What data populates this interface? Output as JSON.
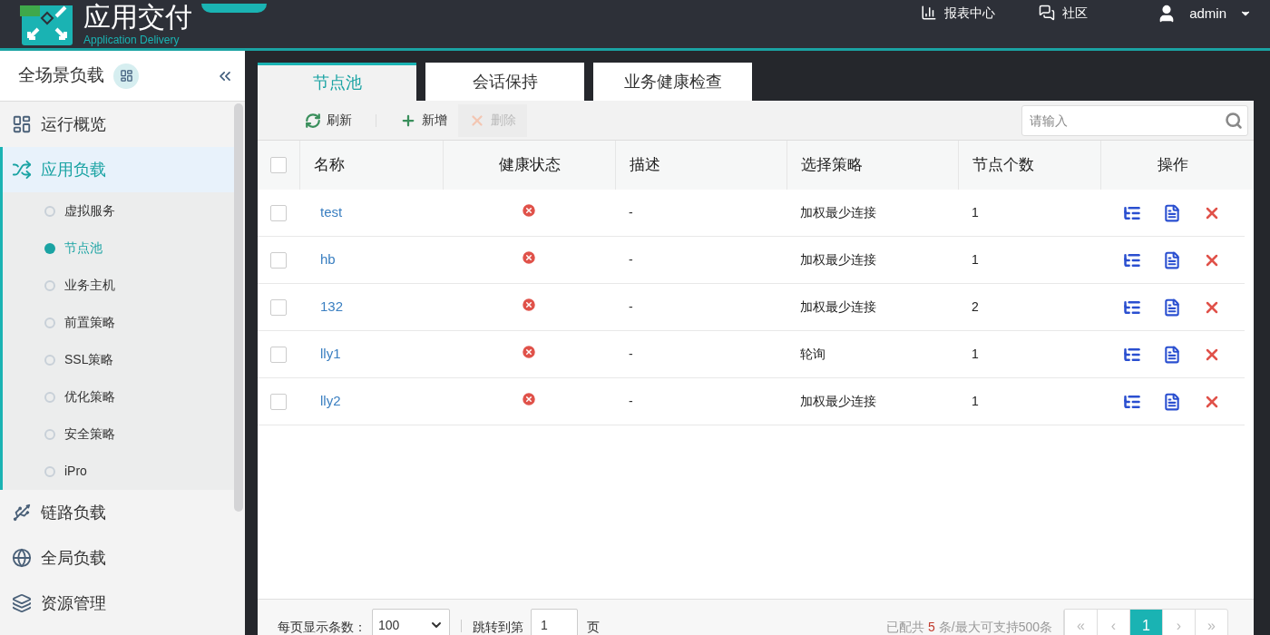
{
  "header": {
    "title": "应用交付",
    "subtitle": "Application Delivery",
    "links": [
      {
        "label": "报表中心"
      },
      {
        "label": "社区"
      }
    ],
    "user": "admin"
  },
  "sidebar": {
    "title": "全场景负载",
    "items": [
      {
        "label": "运行概览",
        "selected": false
      },
      {
        "label": "应用负载",
        "selected": true,
        "expanded": true,
        "children": [
          {
            "label": "虚拟服务",
            "selected": false
          },
          {
            "label": "节点池",
            "selected": true
          },
          {
            "label": "业务主机",
            "selected": false
          },
          {
            "label": "前置策略",
            "selected": false
          },
          {
            "label": "SSL策略",
            "selected": false
          },
          {
            "label": "优化策略",
            "selected": false
          },
          {
            "label": "安全策略",
            "selected": false
          },
          {
            "label": "iPro",
            "selected": false
          }
        ]
      },
      {
        "label": "链路负载",
        "selected": false
      },
      {
        "label": "全局负载",
        "selected": false
      },
      {
        "label": "资源管理",
        "selected": false
      }
    ]
  },
  "tabs": [
    {
      "label": "节点池",
      "selected": true
    },
    {
      "label": "会话保持",
      "selected": false
    },
    {
      "label": "业务健康检查",
      "selected": false
    }
  ],
  "toolbar": {
    "buttons": [
      {
        "label": "刷新",
        "disabled": false
      },
      {
        "label": "新增",
        "disabled": false
      },
      {
        "label": "删除",
        "disabled": true
      }
    ],
    "search": {
      "placeholder": "请输入"
    }
  },
  "table": {
    "all_checked": false,
    "columns": [
      "名称",
      "健康状态",
      "描述",
      "选择策略",
      "节点个数",
      "操作"
    ],
    "rows": [
      {
        "checked": false,
        "name": "test",
        "healthy": false,
        "description": "-",
        "strategy": "加权最少连接",
        "count": "1"
      },
      {
        "checked": false,
        "name": "hb",
        "healthy": false,
        "description": "-",
        "strategy": "加权最少连接",
        "count": "1"
      },
      {
        "checked": false,
        "name": "132",
        "healthy": false,
        "description": "-",
        "strategy": "加权最少连接",
        "count": "2"
      },
      {
        "checked": false,
        "name": "lly1",
        "healthy": false,
        "description": "-",
        "strategy": "轮询",
        "count": "1"
      },
      {
        "checked": false,
        "name": "lly2",
        "healthy": false,
        "description": "-",
        "strategy": "加权最少连接",
        "count": "1"
      }
    ]
  },
  "footer": {
    "page_size_label": "每页显示条数：",
    "page_size": "100",
    "jump_label": "跳转到第",
    "jump_value": "1",
    "jump_suffix": "页",
    "total_before": "已配共",
    "total_count": "5",
    "total_after": "条/最大可支持500条",
    "pages": [
      {
        "label": "«",
        "selected": false
      },
      {
        "label": "‹",
        "selected": false
      },
      {
        "label": "1",
        "selected": true
      },
      {
        "label": "›",
        "selected": false
      },
      {
        "label": "»",
        "selected": false
      }
    ]
  }
}
